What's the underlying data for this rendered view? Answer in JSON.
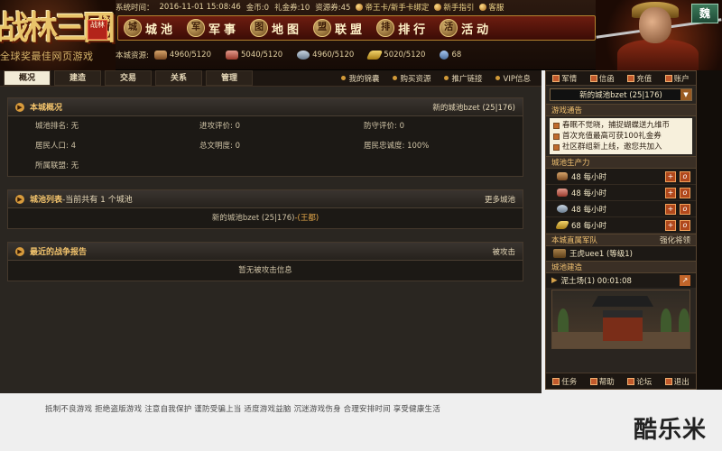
{
  "logo": {
    "title": "战林三國",
    "seal": "战林",
    "slogan": "全球奖最佳网页游戏"
  },
  "infobar": {
    "server_time_label": "系统时间：",
    "server_time": "2016-11-01 15:08:46",
    "gold": "金币:0",
    "coupon": "礼金券:10",
    "resource_coupon": "资源券:45",
    "emperor_card": "帝王卡/新手卡绑定",
    "newbie_guide": "新手指引",
    "customer_service": "客服"
  },
  "nav": [
    {
      "label": "城池",
      "icon": "城"
    },
    {
      "label": "军事",
      "icon": "军"
    },
    {
      "label": "地图",
      "icon": "图"
    },
    {
      "label": "联盟",
      "icon": "盟"
    },
    {
      "label": "排行",
      "icon": "排"
    },
    {
      "label": "活动",
      "icon": "活"
    }
  ],
  "resources": {
    "label": "本城资源:",
    "wood": "4960/5120",
    "meat": "5040/5120",
    "iron": "4960/5120",
    "food": "5020/5120",
    "population": "68"
  },
  "faction_badge": "魏",
  "subtabs": [
    "概况",
    "建造",
    "交易",
    "关系",
    "管理"
  ],
  "sublinks": [
    "我的锦囊",
    "购买资源",
    "推广链接",
    "VIP信息"
  ],
  "overview": {
    "title": "本城概况",
    "city_name": "新的城池bzet (25|176)",
    "rows": [
      [
        "城池排名: 无",
        "进攻评价: 0",
        "防守评价: 0"
      ],
      [
        "居民人口: 4",
        "总文明度: 0",
        "居民忠诚度: 100%"
      ],
      [
        "所属联盟: 无",
        "",
        ""
      ]
    ]
  },
  "city_list": {
    "title": "城池列表",
    "count_text": "-当前共有 1 个城池",
    "more": "更多城池",
    "entry": "新的城池bzet (25|176)",
    "entry_tag": "-(王都)"
  },
  "war_report": {
    "title": "最近的战争报告",
    "attacked": "被攻击",
    "empty": "暂无被攻击信息"
  },
  "side": {
    "top_buttons": [
      "军情",
      "信函",
      "充值",
      "账户"
    ],
    "city_select": "新的城池bzet (25|176)",
    "notice_title": "游戏通告",
    "notices": [
      "春眠不觉晓，捕捉蝴蝶送九维币",
      "首次充值最高可获100礼金券",
      "社区群组新上线，邀您共加入"
    ],
    "production_title": "城池生产力",
    "production": [
      {
        "value": "48 每小时",
        "icon": "wood"
      },
      {
        "value": "48 每小时",
        "icon": "meat"
      },
      {
        "value": "48 每小时",
        "icon": "iron"
      },
      {
        "value": "68 每小时",
        "icon": "food"
      }
    ],
    "army_title": "本城直属军队",
    "army_link": "强化将领",
    "army_entry": "王虎uee1 (等级1)",
    "building_title": "城池建造",
    "building_entry": "泥土场(1)  00:01:08",
    "bottom_buttons": [
      "任务",
      "帮助",
      "论坛",
      "退出"
    ]
  },
  "footer": "抵制不良游戏  拒绝盗版游戏  注意自我保护  谨防受骗上当  适度游戏益脑  沉迷游戏伤身  合理安排时间  享受健康生活",
  "watermark": "酷乐米"
}
